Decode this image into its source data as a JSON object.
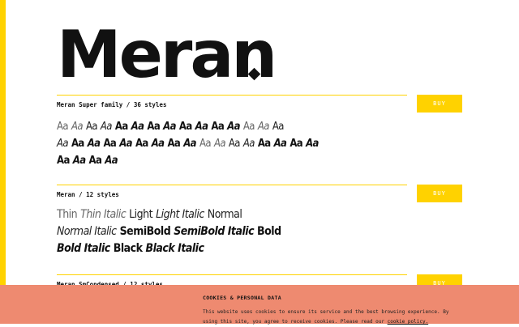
{
  "hero": {
    "title": "Meran"
  },
  "families": [
    {
      "title": "Meran Super family / 36 styles",
      "buy_label": "BUY",
      "sample_rows": [
        [
          {
            "text": "Aa",
            "w": "light",
            "it": false
          },
          {
            "text": "Aa",
            "w": "light",
            "it": true
          },
          {
            "text": "Aa",
            "w": "reg",
            "it": false
          },
          {
            "text": "Aa",
            "w": "reg",
            "it": true
          },
          {
            "text": "Aa",
            "w": "semi",
            "it": false
          },
          {
            "text": "Aa",
            "w": "semi",
            "it": true
          },
          {
            "text": "Aa",
            "w": "bold",
            "it": false
          },
          {
            "text": "Aa",
            "w": "bold",
            "it": true
          },
          {
            "text": "Aa",
            "w": "bold",
            "it": false
          },
          {
            "text": "Aa",
            "w": "bold",
            "it": true
          },
          {
            "text": "Aa",
            "w": "bold",
            "it": false
          },
          {
            "text": "Aa",
            "w": "bold",
            "it": true
          },
          {
            "text": "Aa",
            "w": "light",
            "it": false
          },
          {
            "text": "Aa",
            "w": "light",
            "it": true
          },
          {
            "text": "Aa",
            "w": "reg",
            "it": false
          }
        ],
        [
          {
            "text": "Aa",
            "w": "reg",
            "it": true
          },
          {
            "text": "Aa",
            "w": "semi",
            "it": false
          },
          {
            "text": "Aa",
            "w": "semi",
            "it": true
          },
          {
            "text": "Aa",
            "w": "bold",
            "it": false
          },
          {
            "text": "Aa",
            "w": "bold",
            "it": true
          },
          {
            "text": "Aa",
            "w": "bold",
            "it": false
          },
          {
            "text": "Aa",
            "w": "bold",
            "it": true
          },
          {
            "text": "Aa",
            "w": "bold",
            "it": false
          },
          {
            "text": "Aa",
            "w": "bold",
            "it": true
          },
          {
            "text": "Aa",
            "w": "light",
            "it": false
          },
          {
            "text": "Aa",
            "w": "light",
            "it": true
          },
          {
            "text": "Aa",
            "w": "reg",
            "it": false
          },
          {
            "text": "Aa",
            "w": "reg",
            "it": true
          },
          {
            "text": "Aa",
            "w": "semi",
            "it": false
          },
          {
            "text": "Aa",
            "w": "semi",
            "it": true
          },
          {
            "text": "Aa",
            "w": "bold",
            "it": false
          },
          {
            "text": "Aa",
            "w": "bold",
            "it": true
          }
        ],
        [
          {
            "text": "Aa",
            "w": "bold",
            "it": false
          },
          {
            "text": "Aa",
            "w": "bold",
            "it": true
          },
          {
            "text": "Aa",
            "w": "bold",
            "it": false
          },
          {
            "text": "Aa",
            "w": "bold",
            "it": true
          }
        ]
      ]
    },
    {
      "title": "Meran / 12 styles",
      "buy_label": "BUY",
      "named_rows": [
        [
          {
            "text": "Thin",
            "w": "light",
            "it": false
          },
          {
            "text": "Thin Italic",
            "w": "light",
            "it": true
          },
          {
            "text": "Light",
            "w": "reg",
            "it": false
          },
          {
            "text": "Light Italic",
            "w": "reg",
            "it": true
          },
          {
            "text": "Normal",
            "w": "reg",
            "it": false
          }
        ],
        [
          {
            "text": "Normal Italic",
            "w": "reg",
            "it": true
          },
          {
            "text": "SemiBold",
            "w": "semi",
            "it": false
          },
          {
            "text": "SemiBold Italic",
            "w": "semi",
            "it": true
          },
          {
            "text": "Bold",
            "w": "bold",
            "it": false
          }
        ],
        [
          {
            "text": "Bold Italic",
            "w": "bold",
            "it": true
          },
          {
            "text": "Black",
            "w": "bold",
            "it": false
          },
          {
            "text": "Black Italic",
            "w": "bold",
            "it": true
          }
        ]
      ]
    },
    {
      "title": "Meran SmCondensed / 12 styles",
      "buy_label": "BUY"
    }
  ],
  "cookie": {
    "title": "COOKIES & PERSONAL DATA",
    "text": "This website uses cookies to ensure its service and the best browsing experience. By using this site, you agree to receive cookies. Please read our",
    "link": "cookie policy."
  },
  "colors": {
    "accent": "#ffd200",
    "cookie_bg": "#ee8a70"
  }
}
